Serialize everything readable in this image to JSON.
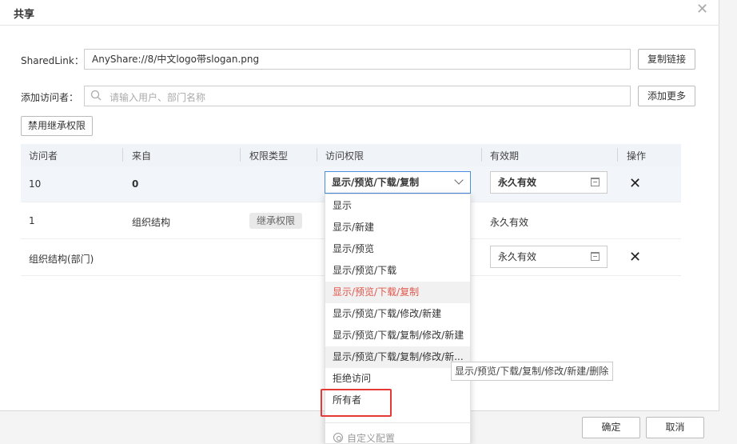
{
  "dialog": {
    "title": "共享"
  },
  "link": {
    "label": "SharedLink：",
    "value": "AnyShare://8/中文logo带slogan.png",
    "copy_label": "复制链接"
  },
  "visitor": {
    "label": "添加访问者：",
    "placeholder": "请输入用户、部门名称",
    "more_label": "添加更多"
  },
  "disable_inherit_label": "禁用继承权限",
  "table": {
    "headers": [
      "访问者",
      "来自",
      "权限类型",
      "访问权限",
      "有效期",
      "操作"
    ],
    "rows": [
      {
        "visitor": "10",
        "from": "0",
        "type": "",
        "permission": "显示/预览/下载/复制",
        "expiry": "永久有效"
      },
      {
        "visitor": "1",
        "from": "组织结构",
        "type": "继承权限",
        "permission": "",
        "expiry": "永久有效"
      },
      {
        "visitor": "组织结构(部门)",
        "from": "",
        "type": "",
        "permission": "",
        "expiry": "永久有效"
      }
    ]
  },
  "dropdown": {
    "options": [
      "显示",
      "显示/新建",
      "显示/预览",
      "显示/预览/下载",
      "显示/预览/下载/复制",
      "显示/预览/下载/修改/新建",
      "显示/预览/下载/复制/修改/新建",
      "显示/预览/下载/复制/修改/新...",
      "拒绝访问",
      "所有者"
    ],
    "selected_index": 4,
    "custom_label": "自定义配置"
  },
  "tooltip": "显示/预览/下载/复制/修改/新建/删除",
  "footer": {
    "ok_label": "确定",
    "cancel_label": "取消"
  },
  "colors": {
    "accent_blue": "#4a90e2",
    "selected_red": "#e2574c",
    "highlight_red": "#e53935"
  }
}
